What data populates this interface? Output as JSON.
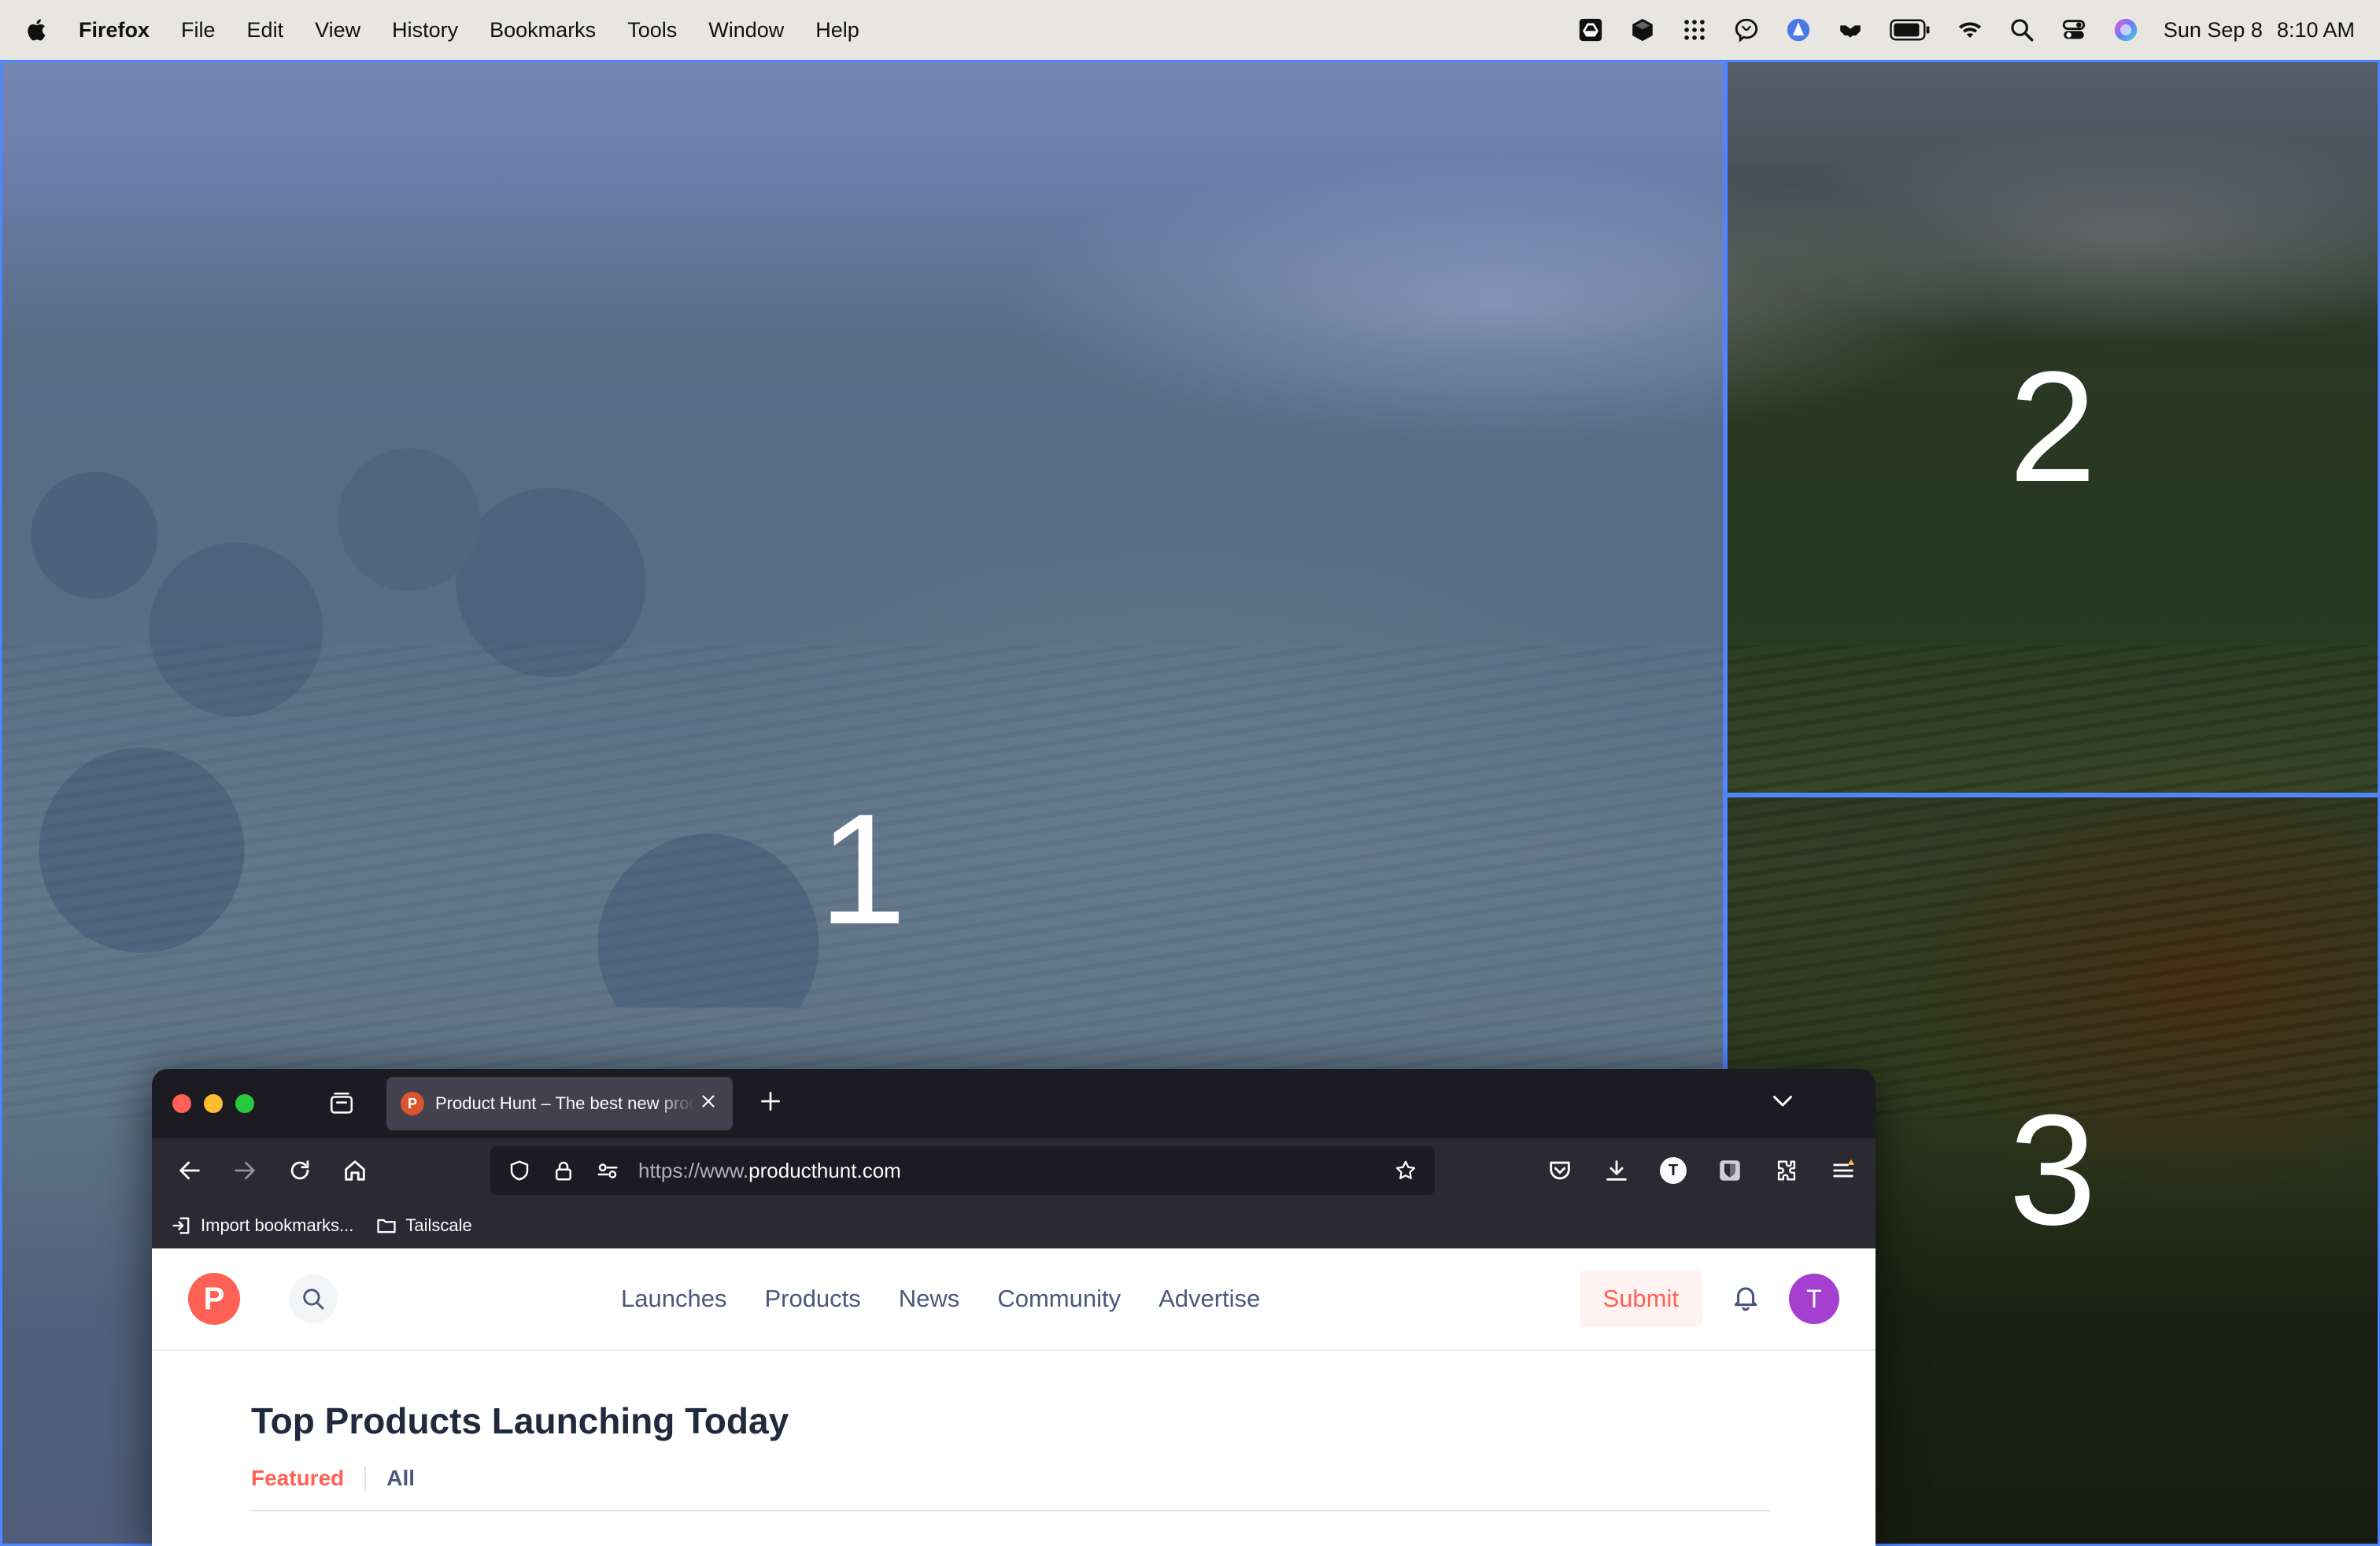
{
  "menubar": {
    "app_name": "Firefox",
    "menus": [
      "File",
      "Edit",
      "View",
      "History",
      "Bookmarks",
      "Tools",
      "Window",
      "Help"
    ],
    "status_icons": [
      "google-drive-icon",
      "dropbox-icon",
      "grid-dots-icon",
      "brain-icon",
      "vpn-shield-icon",
      "handshake-icon",
      "battery-icon",
      "wifi-icon",
      "spotlight-search-icon",
      "control-center-icon",
      "siri-icon"
    ],
    "date": "Sun Sep 8",
    "time": "8:10 AM"
  },
  "snap_zones": {
    "zone_1_label": "1",
    "zone_2_label": "2",
    "zone_3_label": "3",
    "highlight_color": "#4f86ff"
  },
  "browser": {
    "tab": {
      "title": "Product Hunt – The best new products in tech.",
      "favicon_letter": "P"
    },
    "url": {
      "scheme": "https://www.",
      "host": "producthunt.com"
    },
    "toolbar_avatar_letter": "T",
    "bookmarks": [
      {
        "label": "Import bookmarks..."
      },
      {
        "label": "Tailscale"
      }
    ]
  },
  "producthunt": {
    "logo_letter": "P",
    "nav": [
      "Launches",
      "Products",
      "News",
      "Community",
      "Advertise"
    ],
    "submit_label": "Submit",
    "avatar_letter": "T",
    "heading": "Top Products Launching Today",
    "tabs": {
      "featured": "Featured",
      "all": "All"
    },
    "brand_color": "#ff6154"
  }
}
